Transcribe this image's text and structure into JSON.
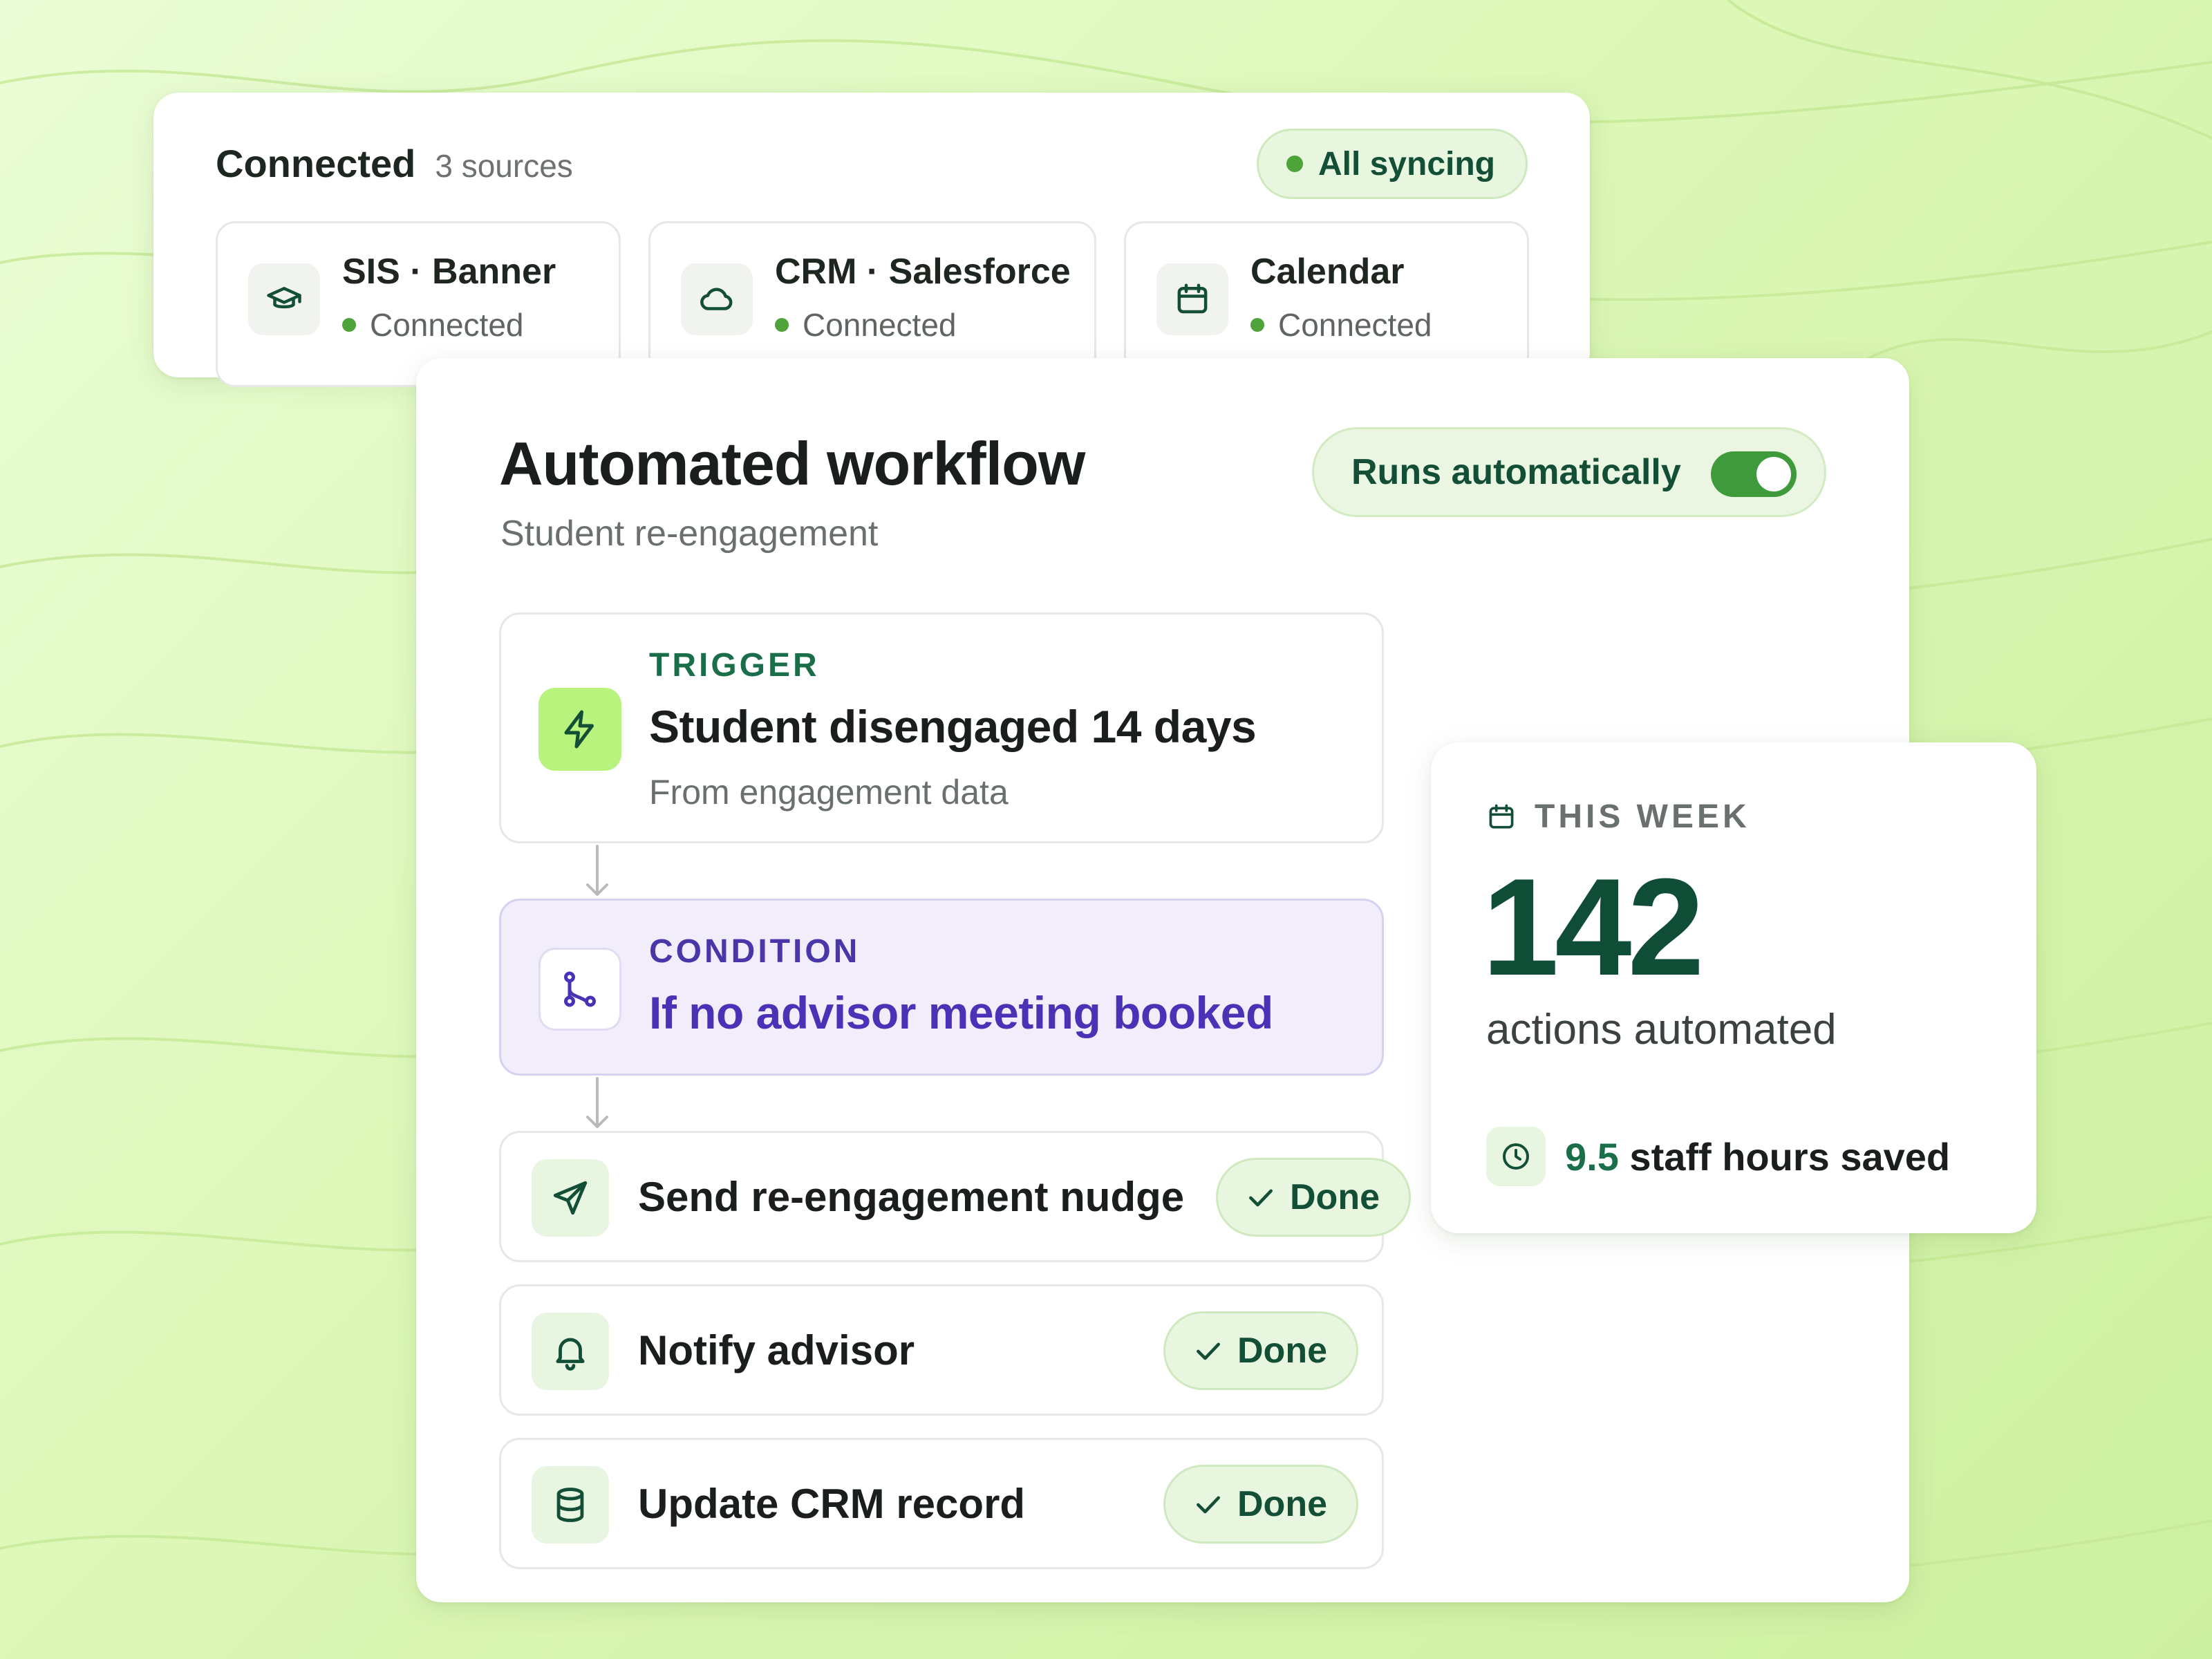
{
  "colors": {
    "accent_green": "#134f36",
    "status_green": "#4ea33a",
    "trigger_icon_bg": "#b8f37e",
    "condition_purple": "#4a32b6",
    "background": "#dcf7b6"
  },
  "sources": {
    "title": "Connected",
    "count": "3 sources",
    "sync_status": "All syncing",
    "items": [
      {
        "name": "SIS · Banner",
        "status": "Connected",
        "icon": "graduation-cap-icon"
      },
      {
        "name": "CRM · Salesforce",
        "status": "Connected",
        "icon": "cloud-icon"
      },
      {
        "name": "Calendar",
        "status": "Connected",
        "icon": "calendar-icon"
      }
    ]
  },
  "workflow": {
    "title": "Automated workflow",
    "subtitle": "Student re-engagement",
    "toggle_label": "Runs automatically",
    "toggle_on": true,
    "trigger": {
      "kicker": "TRIGGER",
      "title": "Student disengaged 14 days",
      "note": "From engagement data",
      "icon": "lightning-icon"
    },
    "condition": {
      "kicker": "CONDITION",
      "title": "If no advisor meeting booked",
      "icon": "branch-icon"
    },
    "actions": [
      {
        "label": "Send re-engagement nudge",
        "status": "Done",
        "icon": "send-icon"
      },
      {
        "label": "Notify advisor",
        "status": "Done",
        "icon": "bell-icon"
      },
      {
        "label": "Update CRM record",
        "status": "Done",
        "icon": "database-icon"
      }
    ]
  },
  "stats": {
    "period": "THIS WEEK",
    "count": "142",
    "caption": "actions automated",
    "hours_value": "9.5",
    "hours_label": " staff hours saved"
  }
}
